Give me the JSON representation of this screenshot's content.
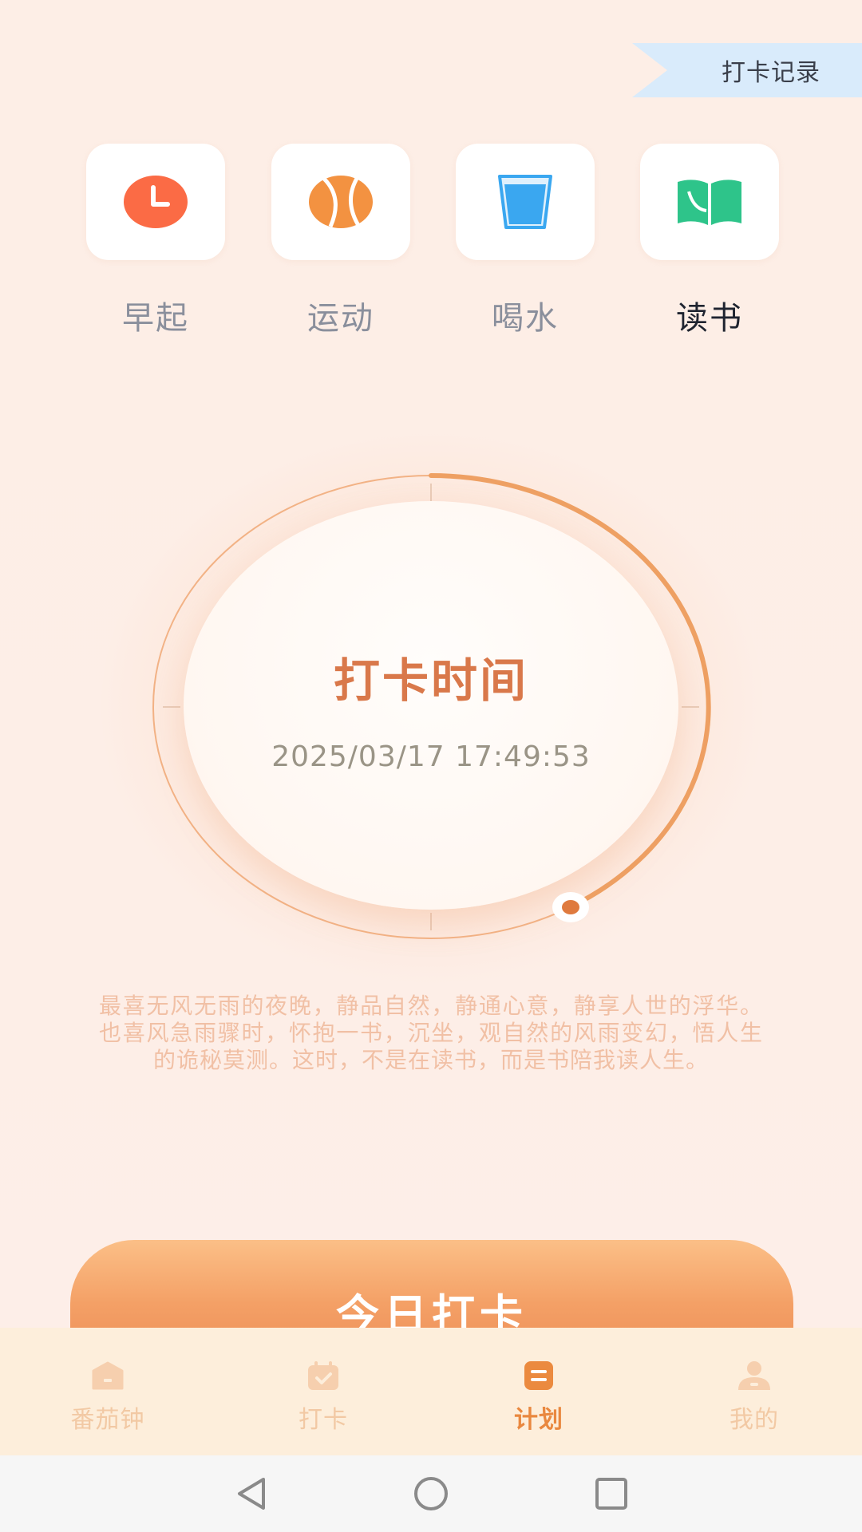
{
  "header": {
    "record_label": "打卡记录"
  },
  "categories": [
    {
      "label": "早起",
      "icon": "alarm-clock-icon",
      "color": "#fb6b45"
    },
    {
      "label": "运动",
      "icon": "ball-icon",
      "color": "#f39241"
    },
    {
      "label": "喝水",
      "icon": "water-glass-icon",
      "color": "#3aa7f0"
    },
    {
      "label": "读书",
      "icon": "open-book-icon",
      "color": "#2ec48a"
    }
  ],
  "active_category": "读书",
  "clock": {
    "title": "打卡时间",
    "time": "2025/03/17 17:49:53",
    "accent": "#e9924f"
  },
  "quote": "最喜无风无雨的夜晚，静品自然，静通心意，静享人世的浮华。也喜风急雨骤时，怀抱一书，沉坐，观自然的风雨变幻，悟人生的诡秘莫测。这时，不是在读书，而是书陪我读人生。",
  "checkin_button": {
    "label": "今日打卡"
  },
  "bottom_nav": [
    {
      "label": "番茄钟",
      "icon": "home-icon",
      "active": false
    },
    {
      "label": "打卡",
      "icon": "calendar-check-icon",
      "active": false
    },
    {
      "label": "计划",
      "icon": "list-icon",
      "active": true
    },
    {
      "label": "我的",
      "icon": "user-icon",
      "active": false
    }
  ],
  "system_nav": [
    {
      "icon": "back-triangle-icon"
    },
    {
      "icon": "home-circle-icon"
    },
    {
      "icon": "recents-square-icon"
    }
  ]
}
